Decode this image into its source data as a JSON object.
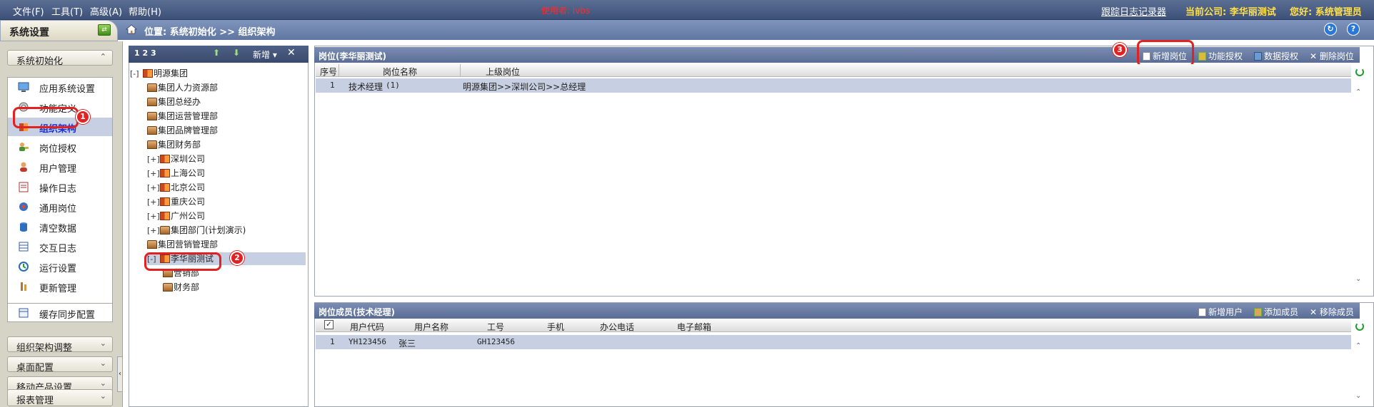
{
  "menubar": {
    "items": [
      "文件(F)",
      "工具(T)",
      "高级(A)",
      "帮助(H)"
    ],
    "user_label": "使用者: lvbs",
    "trace_link": "跟踪日志记录器",
    "company_label": "当前公司: 李华丽测试",
    "greeting": "您好: 系统管理员"
  },
  "header": {
    "tab_title": "系统设置",
    "breadcrumb": "位置: 系统初始化 >> 组织架构"
  },
  "sidebar": {
    "init_section": "系统初始化",
    "items": [
      {
        "label": "应用系统设置",
        "icon": "monitor-icon"
      },
      {
        "label": "功能定义",
        "icon": "gear-icon"
      },
      {
        "label": "组织架构",
        "icon": "org-icon"
      },
      {
        "label": "岗位授权",
        "icon": "users-key-icon"
      },
      {
        "label": "用户管理",
        "icon": "user-icon"
      },
      {
        "label": "操作日志",
        "icon": "log-icon"
      },
      {
        "label": "通用岗位",
        "icon": "post-icon"
      },
      {
        "label": "清空数据",
        "icon": "database-icon"
      },
      {
        "label": "交互日志",
        "icon": "table-icon"
      },
      {
        "label": "运行设置",
        "icon": "run-icon"
      },
      {
        "label": "更新管理",
        "icon": "update-icon"
      },
      {
        "label": "缓存同步配置",
        "icon": "cache-icon"
      }
    ],
    "collapsed_sections": [
      "组织架构调整",
      "桌面配置",
      "移动产品设置",
      "报表管理"
    ],
    "collapse_handle": "‹"
  },
  "tree": {
    "toolbar_levels": "1 2 3",
    "toolbar_new": "新增",
    "nodes": [
      {
        "label": "明源集团",
        "exp": "[-]",
        "type": "org"
      },
      {
        "label": "集团人力资源部",
        "exp": "",
        "type": "dept"
      },
      {
        "label": "集团总经办",
        "exp": "",
        "type": "dept"
      },
      {
        "label": "集团运营管理部",
        "exp": "",
        "type": "dept"
      },
      {
        "label": "集团品牌管理部",
        "exp": "",
        "type": "dept"
      },
      {
        "label": "集团财务部",
        "exp": "",
        "type": "dept"
      },
      {
        "label": "深圳公司",
        "exp": "[+]",
        "type": "org"
      },
      {
        "label": "上海公司",
        "exp": "[+]",
        "type": "org"
      },
      {
        "label": "北京公司",
        "exp": "[+]",
        "type": "org"
      },
      {
        "label": "重庆公司",
        "exp": "[+]",
        "type": "org"
      },
      {
        "label": "广州公司",
        "exp": "[+]",
        "type": "org"
      },
      {
        "label": "集团部门(计划演示)",
        "exp": "[+]",
        "type": "dept"
      },
      {
        "label": "集团营销管理部",
        "exp": "",
        "type": "dept"
      },
      {
        "label": "李华丽测试",
        "exp": "[-]",
        "type": "org"
      },
      {
        "label": "营销部",
        "exp": "",
        "type": "dept"
      },
      {
        "label": "财务部",
        "exp": "",
        "type": "dept"
      }
    ]
  },
  "positions": {
    "title": "岗位(李华丽测试)",
    "buttons": {
      "add": "新增岗位",
      "func_auth": "功能授权",
      "data_auth": "数据授权",
      "delete": "删除岗位"
    },
    "columns": [
      "序号",
      "岗位名称",
      "上级岗位"
    ],
    "rows": [
      {
        "no": "1",
        "name": "技术经理",
        "count": "(1)",
        "parent": "明源集团>>深圳公司>>总经理"
      }
    ]
  },
  "members": {
    "title": "岗位成员(技术经理)",
    "buttons": {
      "add_user": "新增用户",
      "add_member": "添加成员",
      "remove": "移除成员"
    },
    "columns": [
      "用户代码",
      "用户名称",
      "工号",
      "手机",
      "办公电话",
      "电子邮箱"
    ],
    "rows": [
      {
        "no": "1",
        "code": "YH123456",
        "name": "张三",
        "job_no": "GH123456"
      }
    ]
  },
  "annotations": [
    "1",
    "2",
    "3"
  ],
  "colors": {
    "highlight": "#e02222",
    "accent": "#5a6d95",
    "selected_row": "#c7d0e2"
  }
}
